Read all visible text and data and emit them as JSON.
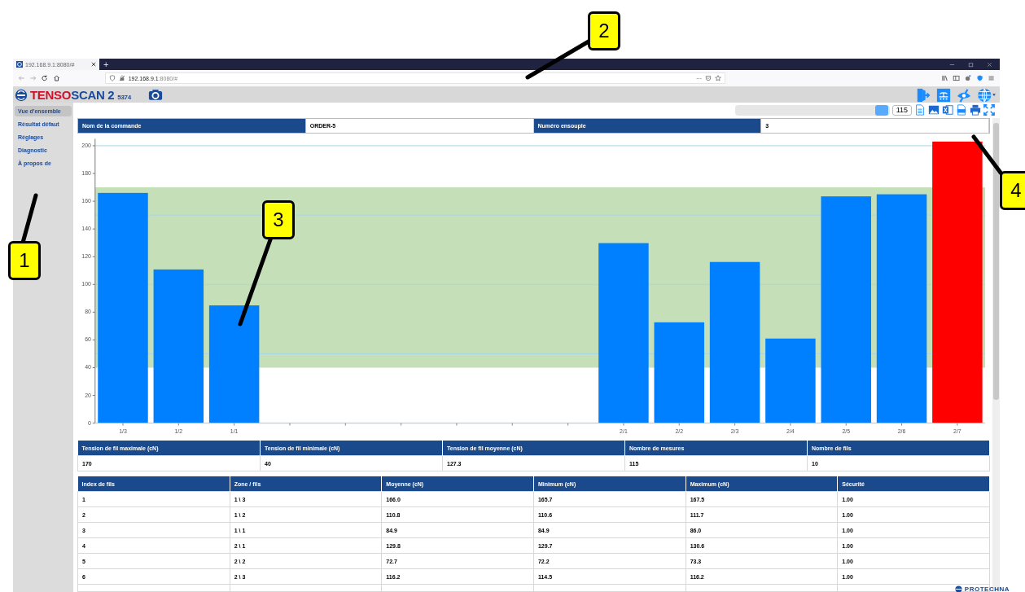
{
  "browser": {
    "tab_title": "192.168.9.1:8080/#",
    "new_tab": "+",
    "address_host": "192.168.9.1",
    "address_rest": ":8080/#",
    "more": "···"
  },
  "app": {
    "brand_a": "TENSO",
    "brand_b": "SCAN 2",
    "serial": "5374"
  },
  "sidebar": {
    "items": [
      {
        "label": "Vue d'ensemble",
        "selected": true
      },
      {
        "label": "Résultat défaut",
        "selected": false
      },
      {
        "label": "Réglages",
        "selected": false
      },
      {
        "label": "Diagnostic",
        "selected": false
      },
      {
        "label": "À propos de",
        "selected": false
      }
    ]
  },
  "toolbar": {
    "slider": {
      "level": 0.95
    },
    "count": "115"
  },
  "order": {
    "fields": [
      {
        "label": "Nom de la commande",
        "value": "ORDER-5"
      },
      {
        "label": "Numéro ensouple",
        "value": "3"
      }
    ]
  },
  "chart": {
    "chart_data": {
      "type": "bar",
      "ylim": [
        0,
        205
      ],
      "stacked": true,
      "categories": [
        "1/3",
        "1/2",
        "1/1",
        null,
        null,
        null,
        null,
        null,
        null,
        "2/1",
        "2/2",
        "2/3",
        "2/4",
        "2/5",
        "2/6",
        "2/7"
      ],
      "yticks": [
        0,
        20,
        40,
        60,
        80,
        100,
        120,
        140,
        160,
        180,
        200
      ],
      "series": [
        {
          "color": "#0080ff",
          "values": [
            166.0,
            110.8,
            84.9,
            null,
            null,
            null,
            null,
            null,
            null,
            129.8,
            72.7,
            116.2,
            61.0,
            163.5,
            165.0,
            null
          ]
        },
        {
          "color": "#ff0000",
          "values": [
            null,
            null,
            null,
            null,
            null,
            null,
            null,
            null,
            null,
            null,
            null,
            null,
            null,
            null,
            null,
            203.0
          ]
        }
      ],
      "bands": [
        {
          "axis": "y",
          "from": 40,
          "to": 170,
          "color": "#c5e0b8"
        }
      ]
    }
  },
  "summary": {
    "columns": [
      "Tension de fil maximale (cN)",
      "Tension de fil minimale (cN)",
      "Tension de fil moyenne (cN)",
      "Nombre de mesures",
      "Nombre de fils"
    ],
    "values": [
      "170",
      "40",
      "127.3",
      "115",
      "10"
    ]
  },
  "table": {
    "columns": [
      "Index de fils",
      "Zone / fils",
      "Moyenne (cN)",
      "Minimum (cN)",
      "Maximum (cN)",
      "Sécurité"
    ],
    "rows": [
      [
        "1",
        "1 \\ 3",
        "166.0",
        "165.7",
        "167.5",
        "1.00"
      ],
      [
        "2",
        "1 \\ 2",
        "110.8",
        "110.6",
        "111.7",
        "1.00"
      ],
      [
        "3",
        "1 \\ 1",
        "84.9",
        "84.9",
        "86.0",
        "1.00"
      ],
      [
        "4",
        "2 \\ 1",
        "129.8",
        "129.7",
        "130.6",
        "1.00"
      ],
      [
        "5",
        "2 \\ 2",
        "72.7",
        "72.2",
        "73.3",
        "1.00"
      ],
      [
        "6",
        "2 \\ 3",
        "116.2",
        "114.5",
        "116.2",
        "1.00"
      ]
    ]
  },
  "footer": {
    "logo": "PROTECHNA"
  },
  "callouts": [
    {
      "label": "1"
    },
    {
      "label": "2"
    },
    {
      "label": "3"
    },
    {
      "label": "4"
    }
  ]
}
